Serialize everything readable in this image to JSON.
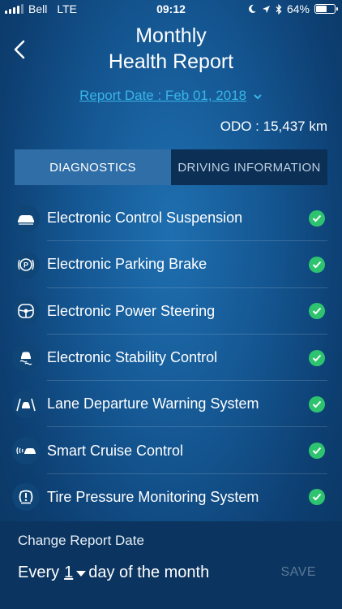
{
  "status_bar": {
    "carrier": "Bell",
    "network": "LTE",
    "time": "09:12",
    "battery": "64%",
    "battery_level": 0.64
  },
  "header": {
    "title_line1": "Monthly",
    "title_line2": "Health Report",
    "report_date": "Report Date : Feb 01, 2018",
    "odo": "ODO : 15,437 km"
  },
  "tabs": [
    {
      "label": "DIAGNOSTICS",
      "active": true
    },
    {
      "label": "DRIVING INFORMATION",
      "active": false
    }
  ],
  "diagnostics": [
    {
      "label": "Electronic Control Suspension",
      "icon": "car-suspension-icon",
      "status": "ok"
    },
    {
      "label": "Electronic Parking Brake",
      "icon": "parking-brake-icon",
      "status": "ok"
    },
    {
      "label": "Electronic Power Steering",
      "icon": "steering-wheel-icon",
      "status": "ok"
    },
    {
      "label": "Electronic Stability Control",
      "icon": "stability-control-icon",
      "status": "ok"
    },
    {
      "label": "Lane Departure Warning System",
      "icon": "lane-departure-icon",
      "status": "ok"
    },
    {
      "label": "Smart Cruise Control",
      "icon": "cruise-control-icon",
      "status": "ok"
    },
    {
      "label": "Tire Pressure Monitoring System",
      "icon": "tire-pressure-icon",
      "status": "ok"
    }
  ],
  "change_report": {
    "label": "Change Report Date",
    "prefix": "Every",
    "day_value": "1",
    "suffix": "day of the month",
    "save_label": "SAVE"
  },
  "colors": {
    "accent": "#39b5e8",
    "check_green": "#2ec46f",
    "tab_active": "#2f6ea6"
  }
}
